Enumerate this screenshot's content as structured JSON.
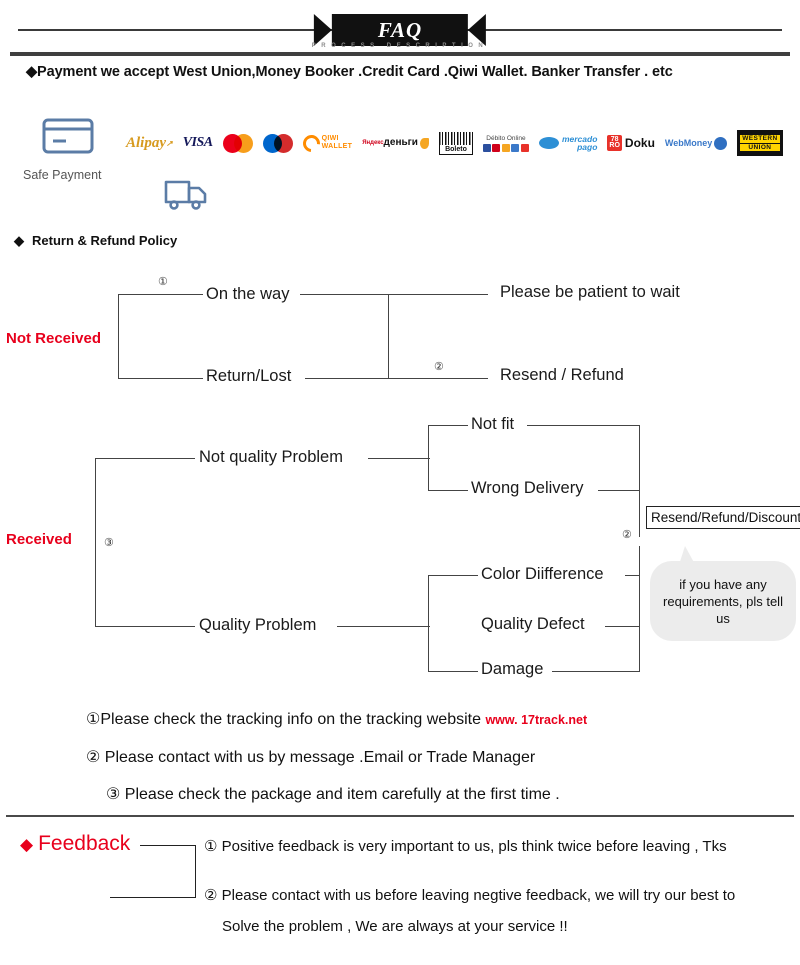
{
  "header": {
    "banner_title": "FAQ",
    "banner_subtitle": "PROCESS DESCRIPTION"
  },
  "payment": {
    "headline": "◆Payment we accept West Union,Money Booker .Credit Card .Qiwi Wallet. Banker Transfer . etc",
    "safe_payment_label": "Safe Payment",
    "card_icon_name": "credit-card-icon",
    "truck_icon_name": "shipping-truck-icon",
    "logos": [
      {
        "name": "alipay-logo",
        "text": "Alipay"
      },
      {
        "name": "visa-logo",
        "text": "VISA"
      },
      {
        "name": "mastercard-logo",
        "text": "Mastercard"
      },
      {
        "name": "maestro-logo",
        "text": "Maestro"
      },
      {
        "name": "qiwi-wallet-logo",
        "line1": "QIWI",
        "line2": "WALLET"
      },
      {
        "name": "yandex-dengi-logo",
        "line1": "Яндекс",
        "line2": "деньги"
      },
      {
        "name": "boleto-logo",
        "text": "Boleto"
      },
      {
        "name": "debito-online-logo",
        "text": "Débito Online"
      },
      {
        "name": "mercado-pago-logo",
        "line1": "mercado",
        "line2": "pago"
      },
      {
        "name": "doku-logo",
        "box1": "78",
        "box2": "RO",
        "text": "Doku"
      },
      {
        "name": "webmoney-logo",
        "text": "WebMoney"
      },
      {
        "name": "western-union-logo",
        "line1": "WESTERN",
        "line2": "UNION"
      }
    ]
  },
  "return_policy": {
    "section_title": "Return & Refund Policy",
    "diamond": "◆",
    "not_received": {
      "label": "Not Received",
      "marker_1": "①",
      "marker_2": "②",
      "branches": [
        "On the way",
        "Return/Lost"
      ],
      "outcomes": [
        "Please be patient to wait",
        "Resend / Refund"
      ]
    },
    "received": {
      "label": "Received",
      "marker_3": "③",
      "marker_2": "②",
      "branch_a": "Not quality Problem",
      "branch_a_items": [
        "Not fit",
        "Wrong Delivery"
      ],
      "branch_b": "Quality Problem",
      "branch_b_items": [
        "Color Diifference",
        "Quality Defect",
        "Damage"
      ],
      "outcome_box": "Resend/Refund/Discount",
      "bubble_line1": "if you have any",
      "bubble_line2": "requirements, pls tell us"
    }
  },
  "notes": [
    {
      "marker": "①",
      "text": "Please check the tracking info on the tracking website",
      "url": "www. 17track.net"
    },
    {
      "marker": "②",
      "text": "Please contact with us by message .Email or Trade Manager",
      "url": ""
    },
    {
      "marker": "③",
      "text": "Please check the package and item carefully at the first time .",
      "url": ""
    }
  ],
  "feedback": {
    "diamond": "◆",
    "title": "Feedback",
    "item1": "① Positive feedback is very important to us, pls think twice before leaving , Tks",
    "item2_line1": "② Please contact with us before leaving negtive feedback, we will try our best to",
    "item2_line2": "Solve the problem , We are always at your service !!"
  },
  "colors": {
    "red": "#e8001c",
    "ink": "#1a1a1a",
    "line": "#444444",
    "bubble": "#ececec",
    "icon_blue": "#5b7ca6"
  }
}
